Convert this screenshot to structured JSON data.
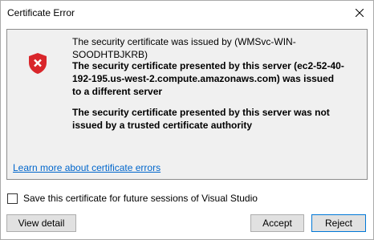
{
  "window": {
    "title": "Certificate Error"
  },
  "messages": {
    "issuer": "The security certificate was issued by (WMSvc-WIN-SOODHTBJKRB)",
    "warning_server": "The security certificate presented by this server (ec2-52-40-192-195.us-west-2.compute.amazonaws.com) was issued to a different server",
    "warning_trust": "The security certificate presented by this server was not issued by a trusted certificate authority"
  },
  "links": {
    "learn_more": "Learn more about certificate errors"
  },
  "save_option": {
    "label": "Save this certificate for future sessions of Visual Studio",
    "checked": false
  },
  "buttons": {
    "view_detail": "View detail",
    "accept": "Accept",
    "reject": "Reject"
  },
  "icons": {
    "close": "close-icon",
    "shield": "shield-error-icon"
  },
  "colors": {
    "shield_red": "#d9262b",
    "link_blue": "#0066cc",
    "default_button_border": "#0078d7",
    "panel_background": "#f0f0f0"
  }
}
